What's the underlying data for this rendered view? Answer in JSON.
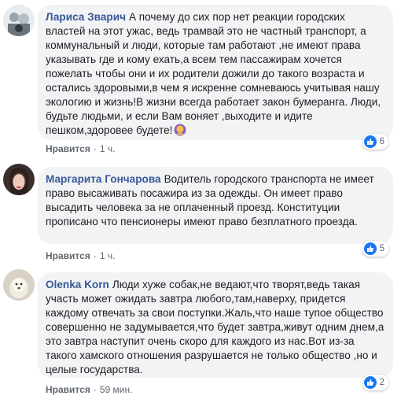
{
  "comments": [
    {
      "author": "Лариса Зварич",
      "text": "А почему до сих пор нет реакции городских властей на этот ужас, ведь трамвай это не частный транспорт, а коммунальный и люди, которые там работают ,не имеют права указывать где и кому ехать,а всем тем пассажирам хочется пожелать чтобы они и их родители дожили до такого возраста и остались здоровыми,в чем я искренне сомневаюсь учитывая нашу экологию и жизнь!В жизни всегда работает закон бумеранга. Люди, будьте людьми, и если Вам воняет ,выходите и идите пешком,здоровее будете!",
      "emoji_icon": "woman-gesture-emoji",
      "like_label": "Нравится",
      "time": "1 ч.",
      "reaction_count": "6"
    },
    {
      "author": "Маргарита Гончарова",
      "text": "Водитель городского транспорта не имеет право высаживать посажира из за одежды. Он имеет право высадить человека за не оплаченный проезд. Конституции прописано что пенсионеры имеют право безплатного проезда.",
      "like_label": "Нравится",
      "time": "1 ч.",
      "reaction_count": "5"
    },
    {
      "author": "Olenka Korn",
      "text": "Люди хуже собак,не ведают,что творят,ведь такая участь может ожидать завтра любого,там,наверху, придется каждому отвечать за свои поступки.Жаль,что наше тупое общество совершенно не задумывается,что будет завтра,живут одним днем,а это завтра наступит очень скоро для каждого из нас.Вот из-за такого хамского отношения разрушается не только общество ,но и целые государства.",
      "like_label": "Нравится",
      "time": "59 мин.",
      "reaction_count": "2"
    }
  ],
  "separator": "·",
  "colors": {
    "author": "#385898",
    "bubble": "#f2f3f5",
    "like_blue": "#1877f2",
    "meta": "#606770"
  }
}
